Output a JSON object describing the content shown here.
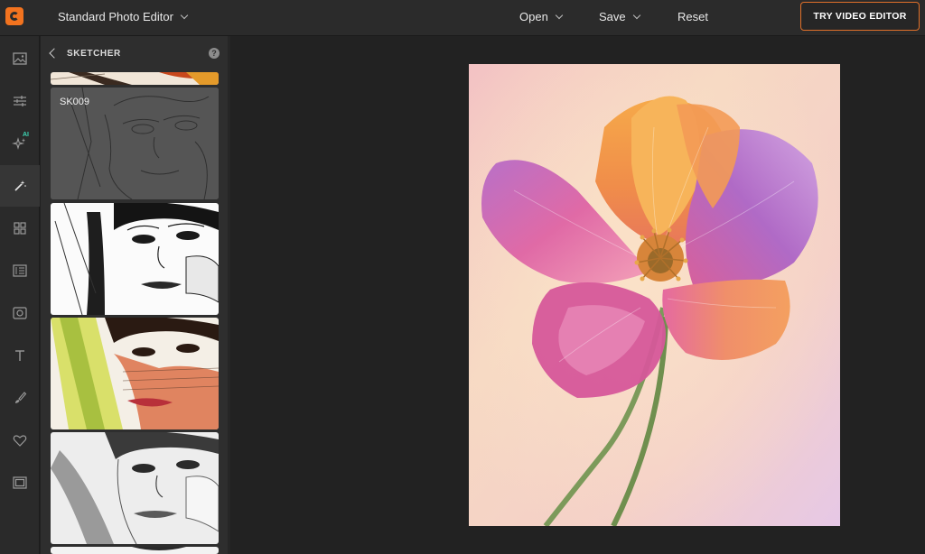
{
  "app": {
    "title": "Standard Photo Editor",
    "logo_icon": "ribbon-c-logo",
    "accent_color": "#f2731f"
  },
  "topbar": {
    "open_label": "Open",
    "save_label": "Save",
    "reset_label": "Reset",
    "try_video_label": "TRY VIDEO EDITOR"
  },
  "rail": {
    "items": [
      {
        "icon": "image-icon"
      },
      {
        "icon": "sliders-icon"
      },
      {
        "icon": "sparkle-ai-icon",
        "badge": "AI"
      },
      {
        "icon": "magic-wand-icon",
        "active": true
      },
      {
        "icon": "grid-icon"
      },
      {
        "icon": "texture-icon"
      },
      {
        "icon": "frame-icon"
      },
      {
        "icon": "text-icon"
      },
      {
        "icon": "brush-icon"
      },
      {
        "icon": "heart-icon"
      },
      {
        "icon": "border-icon"
      }
    ]
  },
  "panel": {
    "title": "SKETCHER",
    "help_icon": "?",
    "thumbnails": [
      {
        "style": "color-sketch-top"
      },
      {
        "label": "SK009",
        "style": "gray-selected"
      },
      {
        "style": "ink-bw"
      },
      {
        "style": "color-pencil"
      },
      {
        "style": "soft-graphite"
      },
      {
        "style": "partial-bottom"
      }
    ]
  },
  "canvas": {
    "image": "pink-orange-poppy-flower"
  }
}
